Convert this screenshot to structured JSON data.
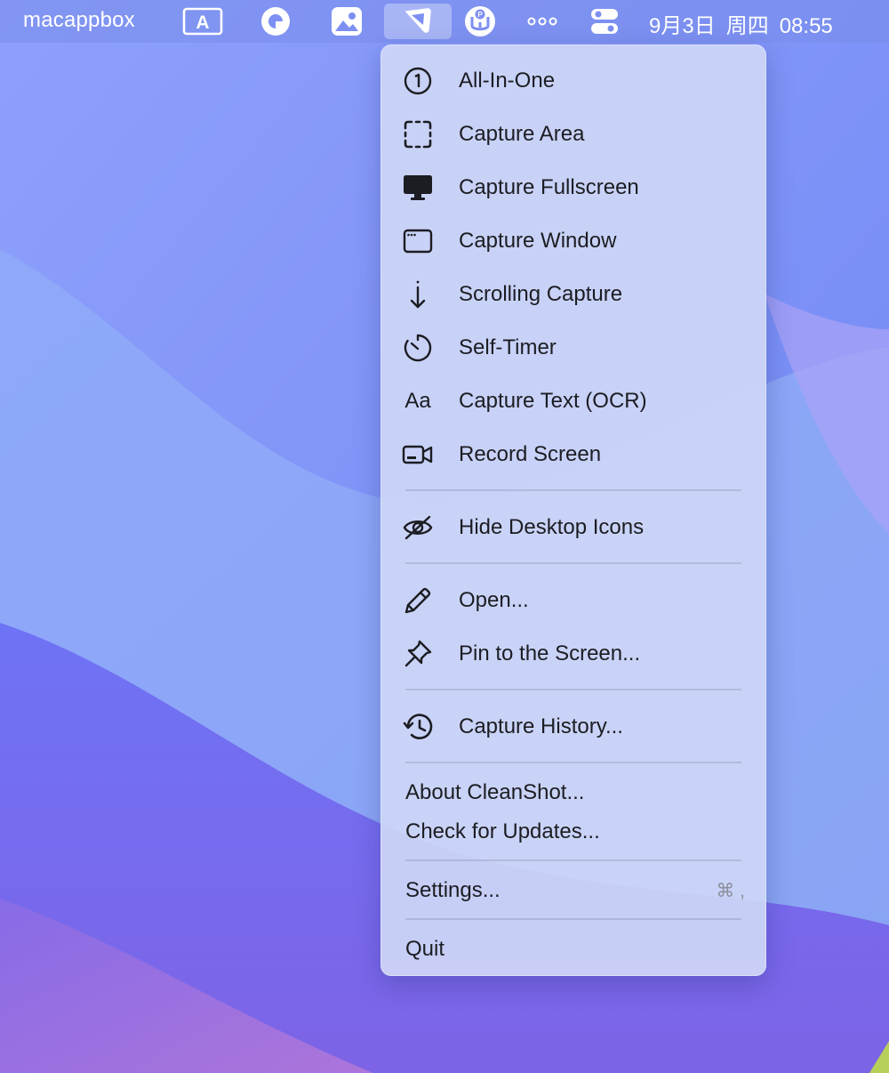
{
  "menubar": {
    "app_name": "macappbox",
    "clock": {
      "date": "9月3日",
      "weekday": "周四",
      "time": "08:55"
    },
    "status_icons": [
      "text-input-icon",
      "color-circle-icon",
      "photos-icon",
      "cleanshot-icon",
      "proxy-icon",
      "more-icon",
      "control-center-icon"
    ]
  },
  "menu": {
    "items": [
      {
        "label": "All-In-One",
        "icon": "all-in-one-icon"
      },
      {
        "label": "Capture Area",
        "icon": "capture-area-icon"
      },
      {
        "label": "Capture Fullscreen",
        "icon": "monitor-icon"
      },
      {
        "label": "Capture Window",
        "icon": "window-icon"
      },
      {
        "label": "Scrolling Capture",
        "icon": "scroll-arrow-icon"
      },
      {
        "label": "Self-Timer",
        "icon": "timer-icon"
      },
      {
        "label": "Capture Text (OCR)",
        "icon": "text-aa-icon",
        "icon_text": "Aa"
      },
      {
        "label": "Record Screen",
        "icon": "video-camera-icon"
      },
      {
        "label": "Hide Desktop Icons",
        "icon": "eye-slash-icon"
      },
      {
        "label": "Open...",
        "icon": "pencil-icon"
      },
      {
        "label": "Pin to the Screen...",
        "icon": "pin-icon"
      },
      {
        "label": "Capture History...",
        "icon": "history-icon"
      },
      {
        "label": "About CleanShot..."
      },
      {
        "label": "Check for Updates..."
      },
      {
        "label": "Settings...",
        "shortcut": "⌘ ,"
      },
      {
        "label": "Quit"
      }
    ]
  }
}
